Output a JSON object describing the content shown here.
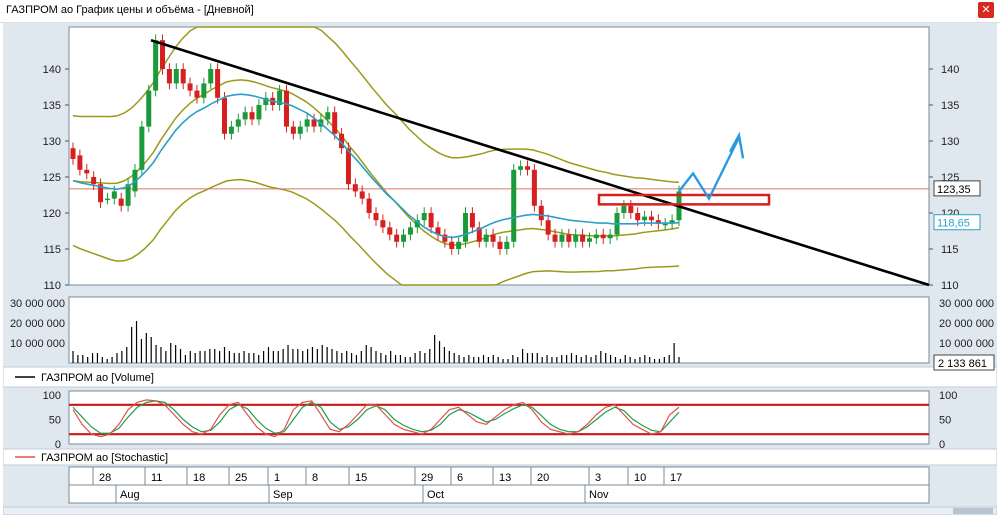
{
  "window": {
    "title": "ГАЗПРОМ ао График цены и объёма - [Дневной]",
    "pin_icon": "pin-icon"
  },
  "colors": {
    "up": "#1a9a3a",
    "down": "#d62020",
    "price_line": "#e07060",
    "ma": "#2aa0c8",
    "band": "#9a9a1a",
    "trend": "#000000",
    "forecast": "#2a9ae0",
    "zone": "#d62020"
  },
  "chart_data": [
    {
      "type": "candlestick",
      "title": "",
      "ylim": [
        110,
        145
      ],
      "y_ticks": [
        110,
        115,
        120,
        125,
        130,
        135,
        140
      ],
      "last_price": "123,35",
      "ma_value": "118,65",
      "candles": [
        [
          129,
          127.5
        ],
        [
          128,
          126
        ],
        [
          126,
          125.5
        ],
        [
          125,
          124
        ],
        [
          124,
          121.5
        ],
        [
          122,
          122
        ],
        [
          122,
          123
        ],
        [
          122,
          121
        ],
        [
          121,
          124
        ],
        [
          123,
          126
        ],
        [
          126,
          132
        ],
        [
          132,
          137
        ],
        [
          137,
          144
        ],
        [
          144,
          140
        ],
        [
          140,
          138
        ],
        [
          138,
          140
        ],
        [
          140,
          138
        ],
        [
          138,
          137
        ],
        [
          137,
          136
        ],
        [
          136,
          138
        ],
        [
          138,
          140
        ],
        [
          140,
          136
        ],
        [
          136,
          131
        ],
        [
          131,
          132
        ],
        [
          132,
          133
        ],
        [
          133,
          134
        ],
        [
          134,
          133
        ],
        [
          133,
          135
        ],
        [
          135,
          136
        ],
        [
          136,
          135
        ],
        [
          135,
          137
        ],
        [
          137,
          132
        ],
        [
          132,
          131
        ],
        [
          131,
          132
        ],
        [
          132,
          133
        ],
        [
          133,
          132
        ],
        [
          132,
          133
        ],
        [
          133,
          134
        ],
        [
          134,
          131
        ],
        [
          131,
          129
        ],
        [
          129,
          124
        ],
        [
          124,
          123
        ],
        [
          123,
          122
        ],
        [
          122,
          120
        ],
        [
          120,
          119
        ],
        [
          119,
          118
        ],
        [
          118,
          117
        ],
        [
          117,
          116
        ],
        [
          116,
          117
        ],
        [
          117,
          118
        ],
        [
          118,
          119
        ],
        [
          119,
          120
        ],
        [
          120,
          118
        ],
        [
          118,
          117
        ],
        [
          117,
          116
        ],
        [
          116,
          115
        ],
        [
          115,
          116
        ],
        [
          116,
          120
        ],
        [
          120,
          118
        ],
        [
          118,
          116
        ],
        [
          116,
          117
        ],
        [
          117,
          116
        ],
        [
          116,
          115
        ],
        [
          115,
          116
        ],
        [
          116,
          126
        ],
        [
          126,
          126.5
        ],
        [
          126.5,
          126
        ],
        [
          126,
          121
        ],
        [
          121,
          119
        ],
        [
          119,
          117
        ],
        [
          117,
          116
        ],
        [
          116,
          117
        ],
        [
          117,
          116
        ],
        [
          116,
          117
        ],
        [
          117,
          116
        ],
        [
          116,
          116.5
        ],
        [
          116.5,
          117
        ],
        [
          117,
          116.5
        ],
        [
          116.5,
          117
        ],
        [
          117,
          120
        ],
        [
          120,
          121
        ],
        [
          121,
          120
        ],
        [
          120,
          119
        ],
        [
          119,
          119.5
        ],
        [
          119.5,
          119
        ],
        [
          119,
          118.5
        ],
        [
          118.5,
          118.5
        ],
        [
          118.5,
          119
        ],
        [
          119,
          123
        ]
      ],
      "sma": [
        124.5,
        124.2,
        124,
        123.8,
        123.6,
        123.4,
        123.3,
        123.5,
        124,
        124.8,
        125.8,
        127,
        128.6,
        130,
        131.4,
        132.5,
        133.4,
        134.1,
        134.6,
        135.2,
        135.7,
        136.2,
        136.4,
        136.5,
        136.4,
        136.2,
        135.9,
        135.6,
        135.4,
        135.2,
        134.9,
        134.4,
        133.9,
        133.2,
        132.4,
        131.5,
        130.6,
        129.5,
        128.3,
        127.2,
        126,
        124.8,
        123.7,
        122.6,
        121.7,
        120.7,
        119.7,
        118.9,
        118.1,
        117.5,
        117,
        116.7,
        116.6,
        116.8,
        117.1,
        117.5,
        117.9,
        118.4,
        118.8,
        119.1,
        119.3,
        119.5,
        119.7,
        119.8,
        119.7,
        119.6,
        119.4,
        119.2,
        119,
        118.9,
        118.8,
        118.7,
        118.6,
        118.6,
        118.5,
        118.5,
        118.5,
        118.5,
        118.6,
        118.6,
        118.6,
        118.6,
        118.6,
        118.65
      ]
    },
    {
      "type": "bar",
      "title": "ГАЗПРОМ ао [Volume]",
      "ylim": [
        0,
        30000000
      ],
      "y_ticks": [
        "30 000 000",
        "20 000 000",
        "10 000 000"
      ],
      "last_value": "2 133 861",
      "values": [
        6,
        4,
        4,
        3,
        5,
        5,
        3,
        2,
        3,
        5,
        6,
        8,
        18,
        21,
        12,
        15,
        13,
        9,
        8,
        6,
        10,
        9,
        7,
        4,
        6,
        5,
        6,
        6,
        7,
        7,
        6,
        8,
        6,
        5,
        5,
        6,
        5,
        5,
        4,
        6,
        8,
        6,
        6,
        7,
        9,
        7,
        7,
        6,
        7,
        8,
        7,
        9,
        8,
        7,
        6,
        5,
        6,
        5,
        4,
        6,
        9,
        8,
        6,
        5,
        4,
        6,
        4,
        4,
        3,
        3,
        5,
        6,
        5,
        7,
        14,
        11,
        8,
        6,
        5,
        4,
        3,
        4,
        3,
        3,
        4,
        3,
        4,
        3,
        2,
        2,
        4,
        3,
        7,
        5,
        5,
        5,
        3,
        4,
        3,
        3,
        4,
        4,
        5,
        4,
        3,
        4,
        3,
        4,
        6,
        5,
        4,
        3,
        2,
        4,
        3,
        2,
        3,
        4,
        3,
        2,
        2,
        3,
        4,
        10,
        3
      ]
    },
    {
      "type": "line",
      "title": "ГАЗПРОМ ао [Stochastic]",
      "ylim": [
        0,
        100
      ],
      "y_ticks": [
        100,
        50,
        0
      ],
      "levels": [
        80,
        20
      ],
      "k": [
        70,
        40,
        20,
        15,
        20,
        40,
        70,
        85,
        90,
        88,
        80,
        60,
        40,
        25,
        20,
        30,
        60,
        80,
        85,
        60,
        35,
        20,
        15,
        30,
        70,
        85,
        88,
        60,
        30,
        25,
        40,
        60,
        80,
        80,
        60,
        40,
        30,
        25,
        20,
        30,
        50,
        70,
        75,
        60,
        45,
        40,
        55,
        70,
        80,
        85,
        70,
        45,
        30,
        25,
        20,
        25,
        40,
        60,
        75,
        80,
        60,
        40,
        30,
        20,
        25,
        60,
        75
      ],
      "d": [
        75,
        55,
        35,
        22,
        22,
        32,
        55,
        75,
        85,
        88,
        85,
        70,
        50,
        35,
        25,
        28,
        45,
        70,
        80,
        72,
        50,
        32,
        22,
        25,
        50,
        75,
        85,
        75,
        45,
        30,
        35,
        50,
        70,
        78,
        70,
        50,
        38,
        30,
        25,
        28,
        40,
        60,
        70,
        65,
        55,
        45,
        50,
        62,
        72,
        80,
        75,
        58,
        40,
        30,
        25,
        25,
        35,
        50,
        65,
        75,
        68,
        50,
        38,
        28,
        25,
        45,
        65
      ]
    }
  ],
  "time_axis": {
    "day_labels": [
      "28",
      "11",
      "18",
      "25",
      "1",
      "8",
      "15",
      "29",
      "6",
      "13",
      "20",
      "3",
      "10",
      "17"
    ],
    "month_labels": [
      "Aug",
      "Sep",
      "Oct",
      "Nov"
    ]
  }
}
